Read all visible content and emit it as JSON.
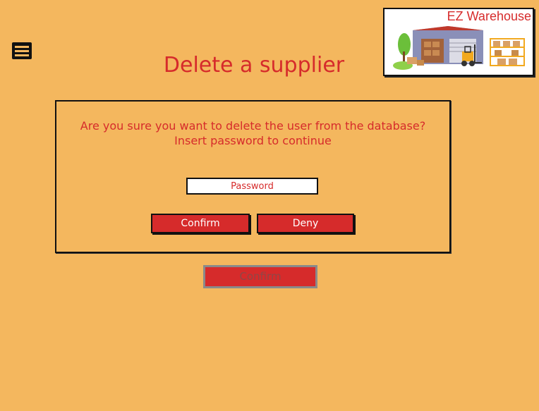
{
  "header": {
    "title": "Delete a supplier",
    "menu_icon": "menu-icon"
  },
  "logo": {
    "text": "EZ Warehouse",
    "illustration": "warehouse-illustration"
  },
  "dialog": {
    "question_line1": "Are you sure you want to delete the user from the database?",
    "question_line2": "Insert password to continue",
    "password_placeholder": "Password",
    "confirm_label": "Confirm",
    "deny_label": "Deny"
  },
  "footer": {
    "confirm_label": "Confirm"
  },
  "colors": {
    "background": "#f4b75e",
    "accent": "#d62b2b",
    "disabled_border": "#8a8a8a"
  }
}
